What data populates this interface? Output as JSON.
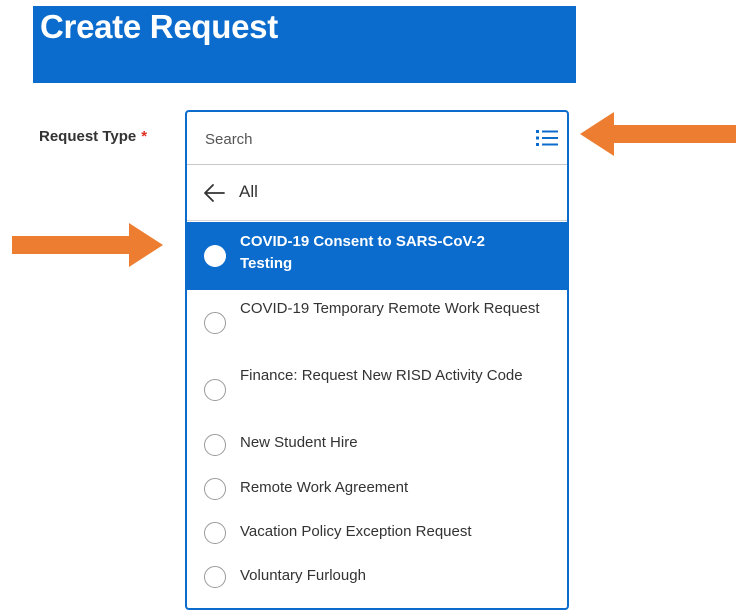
{
  "header": {
    "title": "Create Request"
  },
  "form": {
    "label": "Request Type",
    "required_marker": "*",
    "search_placeholder": "Search"
  },
  "dropdown": {
    "back_label": "All",
    "options": [
      {
        "label": "COVID-19 Consent to SARS-CoV-2 Testing",
        "selected": true
      },
      {
        "label": "COVID-19 Temporary Remote Work Request",
        "selected": false
      },
      {
        "label": "Finance: Request New RISD Activity Code",
        "selected": false
      },
      {
        "label": "New Student Hire",
        "selected": false
      },
      {
        "label": "Remote Work Agreement",
        "selected": false
      },
      {
        "label": "Vacation Policy Exception Request",
        "selected": false
      },
      {
        "label": "Voluntary Furlough",
        "selected": false
      }
    ]
  },
  "icons": {
    "list": "list-icon",
    "back": "arrow-left-icon",
    "annotation": "orange-arrow-icon"
  },
  "colors": {
    "brand_blue": "#0b6ccd",
    "required_red": "#de2e21",
    "annotation_orange": "#ed7d31",
    "text": "#333333"
  }
}
